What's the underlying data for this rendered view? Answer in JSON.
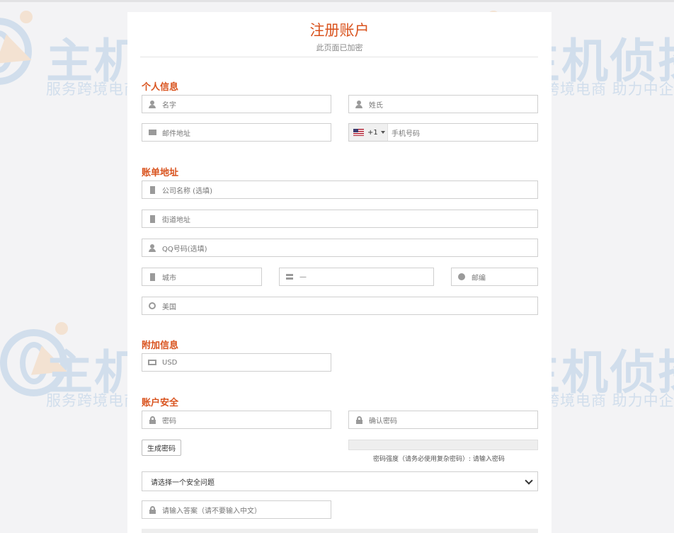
{
  "page": {
    "title": "注册账户",
    "subtitle": "此页面已加密"
  },
  "watermark": {
    "brand": "主机侦探",
    "slogan": "服务跨境电商 助力中企出海"
  },
  "sections": {
    "personal": "个人信息",
    "billing": "账单地址",
    "additional": "附加信息",
    "security": "账户安全"
  },
  "personal": {
    "first_name": "名字",
    "last_name": "姓氏",
    "email": "邮件地址",
    "phone_code": "+1",
    "phone": "手机号码"
  },
  "billing": {
    "company": "公司名称 (选填)",
    "street": "街道地址",
    "qq": "QQ号码(选填)",
    "city": "城市",
    "state": "—",
    "zip": "邮编",
    "country": "美国"
  },
  "additional": {
    "currency": "USD"
  },
  "security": {
    "password": "密码",
    "confirm": "确认密码",
    "generate": "生成密码",
    "strength_note": "密码强度（请务必使用复杂密码）: 请输入密码",
    "question": "请选择一个安全问题",
    "answer": "请输入答案（请不要输入中文）"
  },
  "colors": {
    "accent": "#d9531e",
    "watermark_blue": "#3f86c9",
    "watermark_orange": "#f39a3b"
  },
  "icons": {
    "name": "user-icon",
    "email": "envelope-icon",
    "company": "building-icon",
    "lock": "lock-icon",
    "globe": "globe-icon",
    "currency": "money-icon"
  }
}
